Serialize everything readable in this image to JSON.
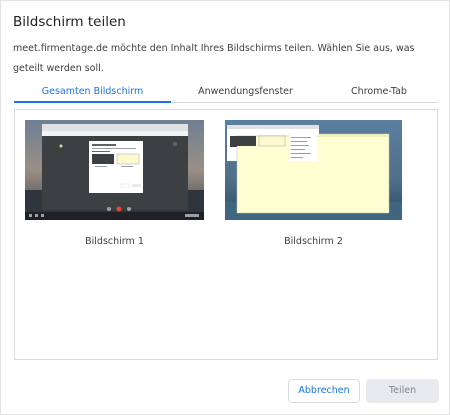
{
  "dialog": {
    "title": "Bildschirm teilen",
    "message": "meet.firmentage.de möchte den Inhalt Ihres Bildschirms teilen. Wählen Sie aus, was geteilt werden soll."
  },
  "tabs": [
    {
      "label": "Gesamten Bildschirm",
      "active": true
    },
    {
      "label": "Anwendungsfenster",
      "active": false
    },
    {
      "label": "Chrome-Tab",
      "active": false
    }
  ],
  "screens": [
    {
      "label": "Bildschirm 1"
    },
    {
      "label": "Bildschirm 2"
    }
  ],
  "buttons": {
    "cancel": "Abbrechen",
    "share": "Teilen"
  },
  "colors": {
    "accent": "#1a73e8",
    "disabled_button_bg": "#e8eaed",
    "disabled_button_text": "#80868b"
  }
}
